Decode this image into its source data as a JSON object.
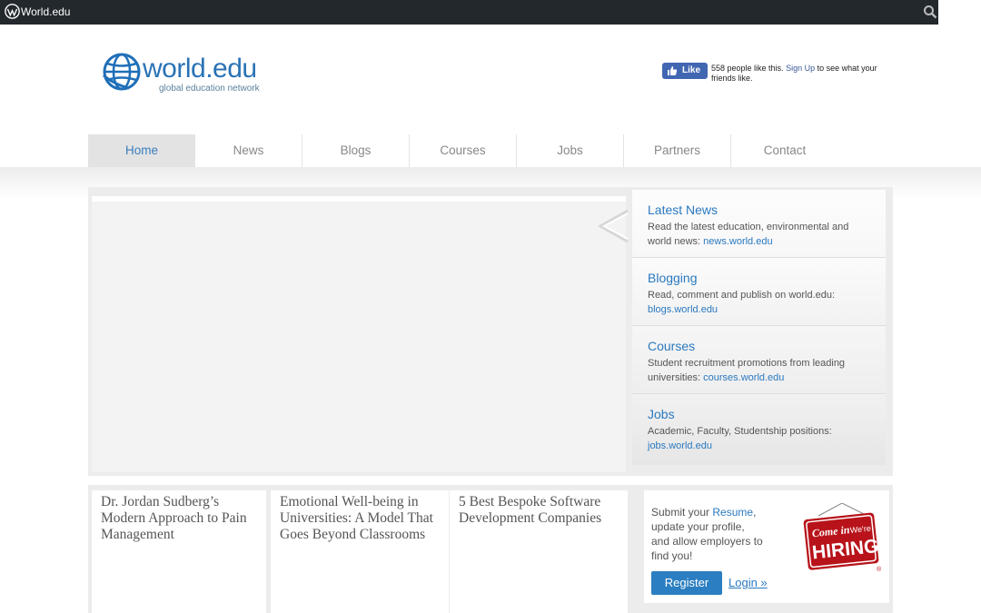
{
  "adminbar": {
    "site_name": "World.edu",
    "wp_icon": "wordpress-icon",
    "search_icon": "search-icon"
  },
  "logo": {
    "name": "world.edu",
    "tagline": "global education network"
  },
  "facebook": {
    "like_label": "Like",
    "text_before": "558 people like this.",
    "signup": "Sign Up",
    "text_after": "to see what your friends like."
  },
  "nav": {
    "tabs": [
      "Home",
      "News",
      "Blogs",
      "Courses",
      "Jobs",
      "Partners",
      "Contact"
    ],
    "active": "Home"
  },
  "sidebar": {
    "items": [
      {
        "title": "Latest News",
        "desc": "Read the latest education, environmental and world news:",
        "link": "news.world.edu"
      },
      {
        "title": "Blogging",
        "desc": "Read, comment and publish on world.edu:",
        "link": "blogs.world.edu"
      },
      {
        "title": "Courses",
        "desc": "Student recruitment promotions from leading universities:",
        "link": "courses.world.edu"
      },
      {
        "title": "Jobs",
        "desc": "Academic, Faculty, Studentship positions:",
        "link": "jobs.world.edu"
      }
    ]
  },
  "stories": [
    "Dr. Jordan Sudberg’s Modern Approach to Pain Management",
    "Emotional Well-being in Universities: A Model That Goes Beyond Classrooms",
    "5 Best Bespoke Software Development Companies"
  ],
  "jobs": {
    "copy_before": "Submit your",
    "resume": "Resume",
    "copy_after": ", update your profile, and allow employers to find you!",
    "register": "Register",
    "login": "Login »",
    "sign_top": "Come in",
    "sign_were": "We're",
    "sign_main": "HIRING",
    "sign_reg": "®"
  },
  "colors": {
    "accent": "#2a79bf",
    "adminbar": "#23282d",
    "register": "#2b7ec1",
    "sign_red": "#c0151c"
  }
}
